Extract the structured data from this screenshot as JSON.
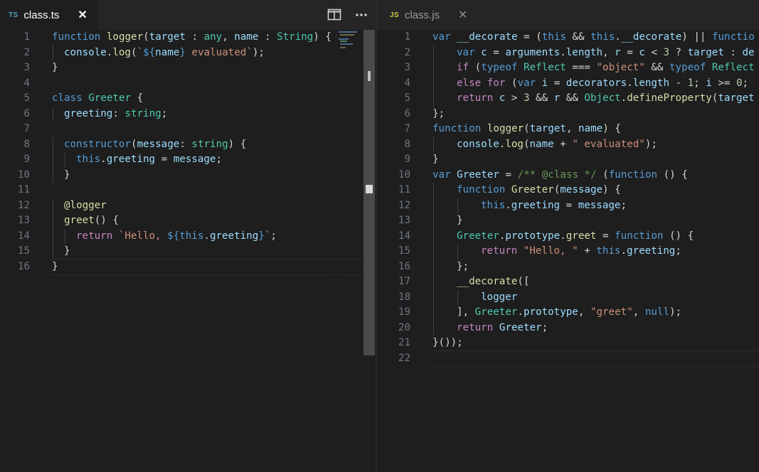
{
  "left_editor": {
    "tab": {
      "badge": "TS",
      "label": "class.ts",
      "close": "✕"
    },
    "toolbar": [
      "split-editor-icon",
      "more-actions-icon"
    ],
    "colors": {
      "badge": "#519aba"
    },
    "lines": [
      {
        "n": "1",
        "indent": 0,
        "tokens": [
          [
            "kw",
            "function"
          ],
          [
            "pl",
            " "
          ],
          [
            "fn",
            "logger"
          ],
          [
            "pl",
            "("
          ],
          [
            "var",
            "target"
          ],
          [
            "pl",
            " : "
          ],
          [
            "ty",
            "any"
          ],
          [
            "pl",
            ", "
          ],
          [
            "var",
            "name"
          ],
          [
            "pl",
            " : "
          ],
          [
            "ty",
            "String"
          ],
          [
            "pl",
            ") {"
          ]
        ]
      },
      {
        "n": "2",
        "indent": 1,
        "tokens": [
          [
            "var",
            "console"
          ],
          [
            "pl",
            "."
          ],
          [
            "fn",
            "log"
          ],
          [
            "pl",
            "("
          ],
          [
            "str",
            "`"
          ],
          [
            "kw",
            "${"
          ],
          [
            "var",
            "name"
          ],
          [
            "kw",
            "}"
          ],
          [
            "str",
            " evaluated`"
          ],
          [
            "pl",
            ");"
          ]
        ]
      },
      {
        "n": "3",
        "indent": 0,
        "tokens": [
          [
            "pl",
            "}"
          ]
        ]
      },
      {
        "n": "4",
        "indent": 0,
        "tokens": []
      },
      {
        "n": "5",
        "indent": 0,
        "tokens": [
          [
            "kw",
            "class"
          ],
          [
            "pl",
            " "
          ],
          [
            "ty",
            "Greeter"
          ],
          [
            "pl",
            " {"
          ]
        ]
      },
      {
        "n": "6",
        "indent": 1,
        "tokens": [
          [
            "var",
            "greeting"
          ],
          [
            "pl",
            ": "
          ],
          [
            "ty",
            "string"
          ],
          [
            "pl",
            ";"
          ]
        ]
      },
      {
        "n": "7",
        "indent": 0,
        "tokens": []
      },
      {
        "n": "8",
        "indent": 1,
        "tokens": [
          [
            "kw",
            "constructor"
          ],
          [
            "pl",
            "("
          ],
          [
            "var",
            "message"
          ],
          [
            "pl",
            ": "
          ],
          [
            "ty",
            "string"
          ],
          [
            "pl",
            ") {"
          ]
        ]
      },
      {
        "n": "9",
        "indent": 2,
        "tokens": [
          [
            "kw",
            "this"
          ],
          [
            "pl",
            "."
          ],
          [
            "var",
            "greeting"
          ],
          [
            "pl",
            " = "
          ],
          [
            "var",
            "message"
          ],
          [
            "pl",
            ";"
          ]
        ]
      },
      {
        "n": "10",
        "indent": 1,
        "tokens": [
          [
            "pl",
            "}"
          ]
        ]
      },
      {
        "n": "11",
        "indent": 0,
        "tokens": []
      },
      {
        "n": "12",
        "indent": 1,
        "tokens": [
          [
            "dec",
            "@logger"
          ]
        ]
      },
      {
        "n": "13",
        "indent": 1,
        "tokens": [
          [
            "fn",
            "greet"
          ],
          [
            "pl",
            "() {"
          ]
        ]
      },
      {
        "n": "14",
        "indent": 2,
        "tokens": [
          [
            "ctl",
            "return"
          ],
          [
            "pl",
            " "
          ],
          [
            "str",
            "`Hello, "
          ],
          [
            "kw",
            "${this"
          ],
          [
            "pl",
            "."
          ],
          [
            "var",
            "greeting"
          ],
          [
            "kw",
            "}"
          ],
          [
            "str",
            "`"
          ],
          [
            "pl",
            ";"
          ]
        ]
      },
      {
        "n": "15",
        "indent": 1,
        "tokens": [
          [
            "pl",
            "}"
          ]
        ]
      },
      {
        "n": "16",
        "indent": 0,
        "tokens": [
          [
            "pl",
            "}"
          ]
        ]
      }
    ]
  },
  "right_editor": {
    "tab": {
      "badge": "JS",
      "label": "class.js",
      "close": "✕"
    },
    "colors": {
      "badge": "#cbcb41"
    },
    "lines": [
      {
        "n": "1",
        "indent": 0,
        "tokens": [
          [
            "kw",
            "var"
          ],
          [
            "pl",
            " "
          ],
          [
            "var",
            "__decorate"
          ],
          [
            "pl",
            " = ("
          ],
          [
            "kw",
            "this"
          ],
          [
            "pl",
            " && "
          ],
          [
            "kw",
            "this"
          ],
          [
            "pl",
            "."
          ],
          [
            "var",
            "__decorate"
          ],
          [
            "pl",
            ") || "
          ],
          [
            "kw",
            "functio"
          ]
        ]
      },
      {
        "n": "2",
        "indent": 1,
        "tokens": [
          [
            "kw",
            "var"
          ],
          [
            "pl",
            " "
          ],
          [
            "var",
            "c"
          ],
          [
            "pl",
            " = "
          ],
          [
            "var",
            "arguments"
          ],
          [
            "pl",
            "."
          ],
          [
            "var",
            "length"
          ],
          [
            "pl",
            ", "
          ],
          [
            "var",
            "r"
          ],
          [
            "pl",
            " = "
          ],
          [
            "var",
            "c"
          ],
          [
            "pl",
            " < "
          ],
          [
            "num",
            "3"
          ],
          [
            "pl",
            " ? "
          ],
          [
            "var",
            "target"
          ],
          [
            "pl",
            " : "
          ],
          [
            "var",
            "de"
          ]
        ]
      },
      {
        "n": "3",
        "indent": 1,
        "tokens": [
          [
            "ctl",
            "if"
          ],
          [
            "pl",
            " ("
          ],
          [
            "kw",
            "typeof"
          ],
          [
            "pl",
            " "
          ],
          [
            "ty",
            "Reflect"
          ],
          [
            "pl",
            " === "
          ],
          [
            "str",
            "\"object\""
          ],
          [
            "pl",
            " && "
          ],
          [
            "kw",
            "typeof"
          ],
          [
            "pl",
            " "
          ],
          [
            "ty",
            "Reflect"
          ]
        ]
      },
      {
        "n": "4",
        "indent": 1,
        "tokens": [
          [
            "ctl",
            "else"
          ],
          [
            "pl",
            " "
          ],
          [
            "ctl",
            "for"
          ],
          [
            "pl",
            " ("
          ],
          [
            "kw",
            "var"
          ],
          [
            "pl",
            " "
          ],
          [
            "var",
            "i"
          ],
          [
            "pl",
            " = "
          ],
          [
            "var",
            "decorators"
          ],
          [
            "pl",
            "."
          ],
          [
            "var",
            "length"
          ],
          [
            "pl",
            " - "
          ],
          [
            "num",
            "1"
          ],
          [
            "pl",
            "; "
          ],
          [
            "var",
            "i"
          ],
          [
            "pl",
            " >= "
          ],
          [
            "num",
            "0"
          ],
          [
            "pl",
            ";"
          ]
        ]
      },
      {
        "n": "5",
        "indent": 1,
        "tokens": [
          [
            "ctl",
            "return"
          ],
          [
            "pl",
            " "
          ],
          [
            "var",
            "c"
          ],
          [
            "pl",
            " > "
          ],
          [
            "num",
            "3"
          ],
          [
            "pl",
            " && "
          ],
          [
            "var",
            "r"
          ],
          [
            "pl",
            " && "
          ],
          [
            "ty",
            "Object"
          ],
          [
            "pl",
            "."
          ],
          [
            "fn",
            "defineProperty"
          ],
          [
            "pl",
            "("
          ],
          [
            "var",
            "target"
          ]
        ]
      },
      {
        "n": "6",
        "indent": 0,
        "tokens": [
          [
            "pl",
            "};"
          ]
        ]
      },
      {
        "n": "7",
        "indent": 0,
        "tokens": [
          [
            "kw",
            "function"
          ],
          [
            "pl",
            " "
          ],
          [
            "fn",
            "logger"
          ],
          [
            "pl",
            "("
          ],
          [
            "var",
            "target"
          ],
          [
            "pl",
            ", "
          ],
          [
            "var",
            "name"
          ],
          [
            "pl",
            ") {"
          ]
        ]
      },
      {
        "n": "8",
        "indent": 1,
        "tokens": [
          [
            "var",
            "console"
          ],
          [
            "pl",
            "."
          ],
          [
            "fn",
            "log"
          ],
          [
            "pl",
            "("
          ],
          [
            "var",
            "name"
          ],
          [
            "pl",
            " + "
          ],
          [
            "str",
            "\" evaluated\""
          ],
          [
            "pl",
            ");"
          ]
        ]
      },
      {
        "n": "9",
        "indent": 0,
        "tokens": [
          [
            "pl",
            "}"
          ]
        ]
      },
      {
        "n": "10",
        "indent": 0,
        "tokens": [
          [
            "kw",
            "var"
          ],
          [
            "pl",
            " "
          ],
          [
            "var",
            "Greeter"
          ],
          [
            "pl",
            " = "
          ],
          [
            "cmt",
            "/** @class */"
          ],
          [
            "pl",
            " ("
          ],
          [
            "kw",
            "function"
          ],
          [
            "pl",
            " () {"
          ]
        ]
      },
      {
        "n": "11",
        "indent": 1,
        "tokens": [
          [
            "kw",
            "function"
          ],
          [
            "pl",
            " "
          ],
          [
            "fn",
            "Greeter"
          ],
          [
            "pl",
            "("
          ],
          [
            "var",
            "message"
          ],
          [
            "pl",
            ") {"
          ]
        ]
      },
      {
        "n": "12",
        "indent": 2,
        "tokens": [
          [
            "kw",
            "this"
          ],
          [
            "pl",
            "."
          ],
          [
            "var",
            "greeting"
          ],
          [
            "pl",
            " = "
          ],
          [
            "var",
            "message"
          ],
          [
            "pl",
            ";"
          ]
        ]
      },
      {
        "n": "13",
        "indent": 1,
        "tokens": [
          [
            "pl",
            "}"
          ]
        ]
      },
      {
        "n": "14",
        "indent": 1,
        "tokens": [
          [
            "ty",
            "Greeter"
          ],
          [
            "pl",
            "."
          ],
          [
            "var",
            "prototype"
          ],
          [
            "pl",
            "."
          ],
          [
            "fn",
            "greet"
          ],
          [
            "pl",
            " = "
          ],
          [
            "kw",
            "function"
          ],
          [
            "pl",
            " () {"
          ]
        ]
      },
      {
        "n": "15",
        "indent": 2,
        "tokens": [
          [
            "ctl",
            "return"
          ],
          [
            "pl",
            " "
          ],
          [
            "str",
            "\"Hello, \""
          ],
          [
            "pl",
            " + "
          ],
          [
            "kw",
            "this"
          ],
          [
            "pl",
            "."
          ],
          [
            "var",
            "greeting"
          ],
          [
            "pl",
            ";"
          ]
        ]
      },
      {
        "n": "16",
        "indent": 1,
        "tokens": [
          [
            "pl",
            "};"
          ]
        ]
      },
      {
        "n": "17",
        "indent": 1,
        "tokens": [
          [
            "fn",
            "__decorate"
          ],
          [
            "pl",
            "(["
          ]
        ]
      },
      {
        "n": "18",
        "indent": 2,
        "tokens": [
          [
            "var",
            "logger"
          ]
        ]
      },
      {
        "n": "19",
        "indent": 1,
        "tokens": [
          [
            "pl",
            "], "
          ],
          [
            "ty",
            "Greeter"
          ],
          [
            "pl",
            "."
          ],
          [
            "var",
            "prototype"
          ],
          [
            "pl",
            ", "
          ],
          [
            "str",
            "\"greet\""
          ],
          [
            "pl",
            ", "
          ],
          [
            "kw",
            "null"
          ],
          [
            "pl",
            ");"
          ]
        ]
      },
      {
        "n": "20",
        "indent": 1,
        "tokens": [
          [
            "ctl",
            "return"
          ],
          [
            "pl",
            " "
          ],
          [
            "var",
            "Greeter"
          ],
          [
            "pl",
            ";"
          ]
        ]
      },
      {
        "n": "21",
        "indent": 0,
        "tokens": [
          [
            "pl",
            "}());"
          ]
        ]
      },
      {
        "n": "22",
        "indent": 0,
        "tokens": []
      }
    ]
  }
}
